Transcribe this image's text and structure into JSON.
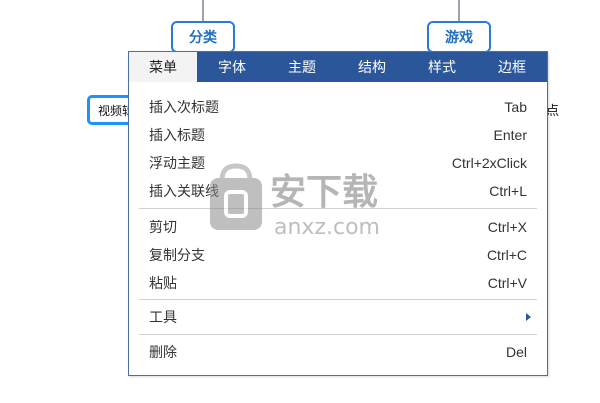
{
  "mindmap": {
    "node_fenlei": "分类",
    "node_youxi": "游戏",
    "node_left_partial": "视频辑",
    "node_right_partial": "点"
  },
  "menu": {
    "tabs": [
      {
        "label": "菜单",
        "active": true
      },
      {
        "label": "字体",
        "active": false
      },
      {
        "label": "主题",
        "active": false
      },
      {
        "label": "结构",
        "active": false
      },
      {
        "label": "样式",
        "active": false
      },
      {
        "label": "边框",
        "active": false
      }
    ],
    "items": {
      "insert_sub": {
        "label": "插入次标题",
        "shortcut": "Tab"
      },
      "insert_title": {
        "label": "插入标题",
        "shortcut": "Enter"
      },
      "float_topic": {
        "label": "浮动主题",
        "shortcut": "Ctrl+2xClick"
      },
      "insert_link": {
        "label": "插入关联线",
        "shortcut": "Ctrl+L"
      },
      "cut": {
        "label": "剪切",
        "shortcut": "Ctrl+X"
      },
      "copy_branch": {
        "label": "复制分支",
        "shortcut": "Ctrl+C"
      },
      "paste": {
        "label": "粘贴",
        "shortcut": "Ctrl+V"
      },
      "tools": {
        "label": "工具"
      },
      "delete": {
        "label": "删除",
        "shortcut": "Del"
      }
    }
  },
  "watermark": {
    "title": "安下载",
    "domain": "anxz.com"
  },
  "colors": {
    "tabbar": "#2b579a",
    "node_border": "#2a7bd4",
    "node_text": "#1f6fc4"
  }
}
